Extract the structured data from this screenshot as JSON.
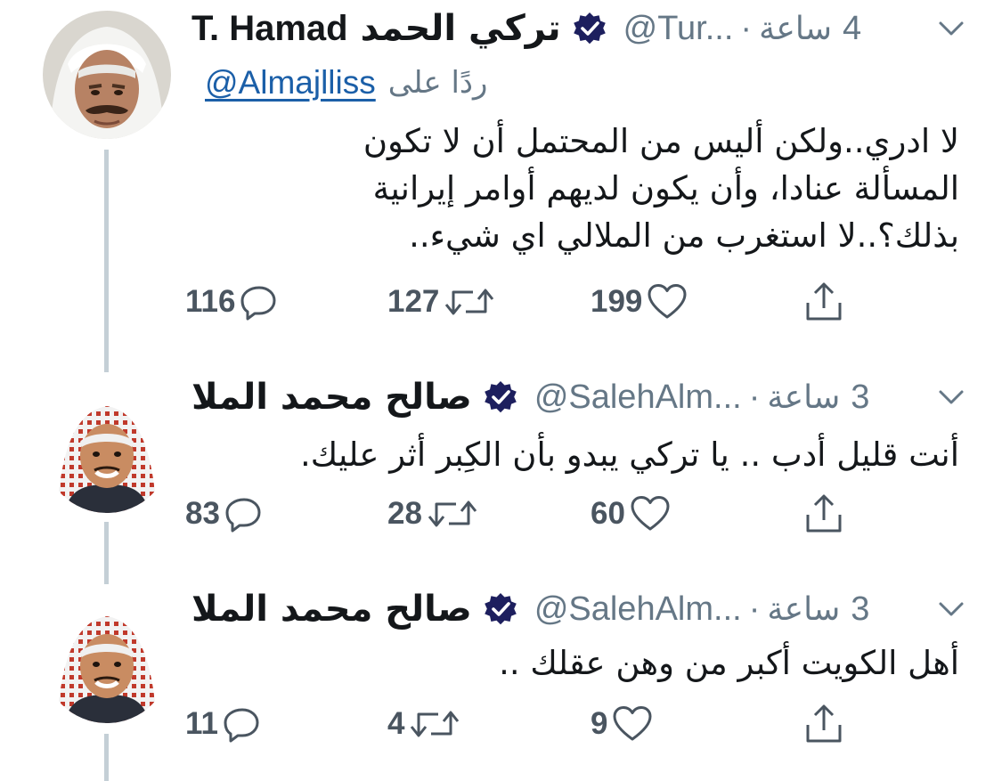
{
  "thread": {
    "tweets": [
      {
        "author_name_latin": "T. Hamad",
        "author_name_arabic": "تركي الحمد",
        "handle": "@Tur...",
        "dot": "·",
        "time_word": "ساعة",
        "time_num": "4",
        "reply_label": "ردًا على",
        "reply_handle": "@Almajlliss",
        "text": "لا ادري..ولكن أليس من المحتمل أن لا تكون\nالمسألة عنادا، وأن يكون لديهم أوامر إيرانية\nبذلك؟..لا استغرب من الملالي اي شيء..",
        "replies": "116",
        "retweets": "127",
        "likes": "199",
        "avatar_icon": "avatar-man-white-ghutra-icon"
      },
      {
        "author_name_arabic": "صالح محمد الملا",
        "handle": "@SalehAlm...",
        "dot": "·",
        "time_word": "ساعة",
        "time_num": "3",
        "text": "أنت قليل أدب .. يا تركي يبدو بأن الكِبر أثر عليك.",
        "replies": "83",
        "retweets": "28",
        "likes": "60",
        "avatar_icon": "avatar-man-red-shemagh-icon"
      },
      {
        "author_name_arabic": "صالح محمد الملا",
        "handle": "@SalehAlm...",
        "dot": "·",
        "time_word": "ساعة",
        "time_num": "3",
        "text": "أهل الكويت أكبر من وهن عقلك ..",
        "replies": "11",
        "retweets": "4",
        "likes": "9",
        "avatar_icon": "avatar-man-red-shemagh-icon"
      }
    ]
  },
  "colors": {
    "verified": "#1d1f5e",
    "secondary_text": "#657786",
    "link": "#1b5fa8",
    "thread_line": "#c4cfd6",
    "icon_stroke": "#4a5560"
  }
}
